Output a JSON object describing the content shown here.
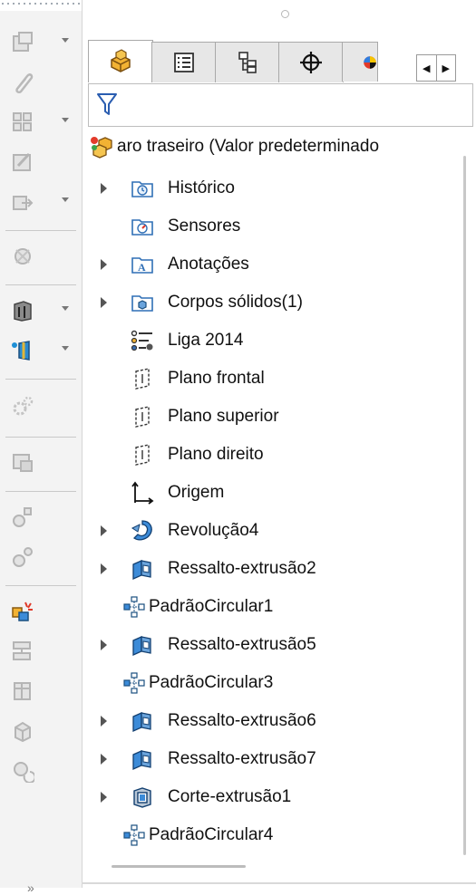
{
  "tabs": [
    {
      "name": "feature-manager",
      "active": true
    },
    {
      "name": "property-manager"
    },
    {
      "name": "configuration-manager"
    },
    {
      "name": "dim-xpert-manager"
    },
    {
      "name": "display-manager"
    }
  ],
  "tab_scroll": {
    "left": "◀",
    "right": "▶"
  },
  "tree": {
    "root": "aro traseiro  (Valor predeterminado",
    "items": [
      {
        "label": "Histórico",
        "icon": "history-folder-icon",
        "expandable": true
      },
      {
        "label": "Sensores",
        "icon": "sensors-folder-icon",
        "expandable": false
      },
      {
        "label": "Anotações",
        "icon": "annotations-folder-icon",
        "expandable": true
      },
      {
        "label": "Corpos sólidos(1)",
        "icon": "solid-bodies-folder-icon",
        "expandable": true
      },
      {
        "label": "Liga 2014",
        "icon": "material-icon",
        "expandable": false
      },
      {
        "label": "Plano frontal",
        "icon": "plane-icon",
        "expandable": false
      },
      {
        "label": "Plano superior",
        "icon": "plane-icon",
        "expandable": false
      },
      {
        "label": "Plano direito",
        "icon": "plane-icon",
        "expandable": false
      },
      {
        "label": "Origem",
        "icon": "origin-icon",
        "expandable": false
      },
      {
        "label": "Revolução4",
        "icon": "revolve-icon",
        "expandable": true
      },
      {
        "label": "Ressalto-extrusão2",
        "icon": "boss-extrude-icon",
        "expandable": true
      },
      {
        "label": "PadrãoCircular1",
        "icon": "circular-pattern-icon",
        "expandable": false
      },
      {
        "label": "Ressalto-extrusão5",
        "icon": "boss-extrude-icon",
        "expandable": true
      },
      {
        "label": "PadrãoCircular3",
        "icon": "circular-pattern-icon",
        "expandable": false
      },
      {
        "label": "Ressalto-extrusão6",
        "icon": "boss-extrude-icon",
        "expandable": true
      },
      {
        "label": "Ressalto-extrusão7",
        "icon": "boss-extrude-icon",
        "expandable": true
      },
      {
        "label": "Corte-extrusão1",
        "icon": "cut-extrude-icon",
        "expandable": true
      },
      {
        "label": "PadrãoCircular4",
        "icon": "circular-pattern-icon",
        "expandable": false
      }
    ]
  },
  "colors": {
    "folder_blue": "#2f6fb6",
    "part_orange": "#e8a323",
    "material_blue": "#3a6fb5",
    "filter_blue": "#2a5db0"
  },
  "left_toolbar": {
    "icons": [
      "new-drawing-icon",
      "attach-icon",
      "layout-icon",
      "edit-sketch-icon",
      "insert-part-icon",
      "mass-icon",
      "view-3d-icon",
      "section-view-icon",
      "gear-settings-icon",
      "display-state-icon",
      "ref-point-icon",
      "ref-point-2-icon",
      "highlight-parts-icon",
      "split-icon",
      "box-icon",
      "component-icon",
      "refresh-icon"
    ],
    "more": "»"
  }
}
